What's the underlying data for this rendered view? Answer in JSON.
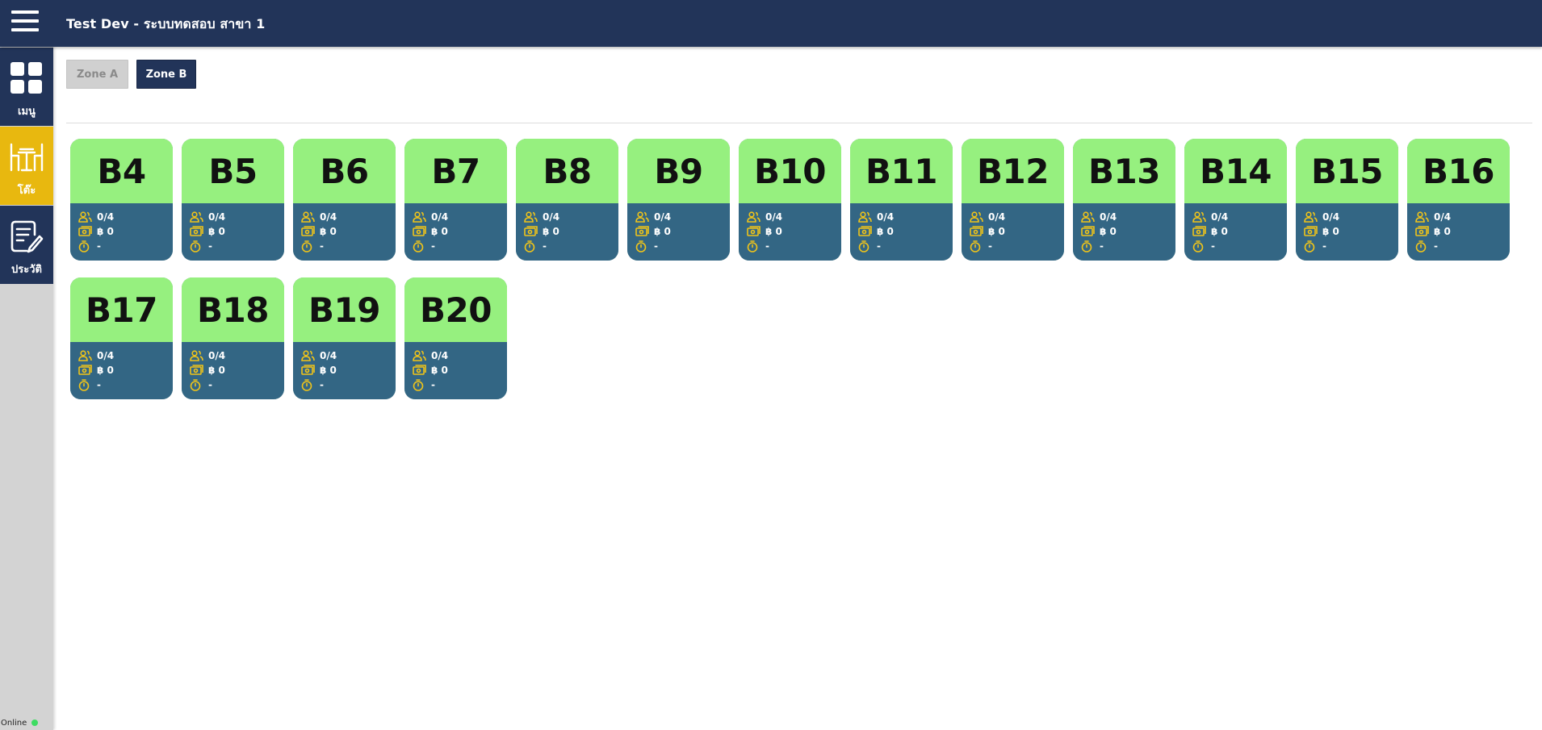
{
  "header": {
    "title": "Test Dev - ระบบทดสอบ สาขา 1"
  },
  "sidebar": {
    "items": [
      {
        "label": "เมนู",
        "icon": "grid-icon"
      },
      {
        "label": "โต๊ะ",
        "icon": "table-chairs-icon",
        "active": true
      },
      {
        "label": "ประวัติ",
        "icon": "history-document-icon"
      }
    ],
    "status": "Online",
    "status_color": "#3ddc62"
  },
  "zones": [
    {
      "label": "Zone A",
      "active": false
    },
    {
      "label": "Zone B",
      "active": true
    }
  ],
  "colors": {
    "header": "#223459",
    "active_nav": "#e8b80f",
    "card_top": "#96f07f",
    "card_bottom": "#336684",
    "icon_accent": "#f0c419"
  },
  "tables": [
    {
      "name": "B4",
      "guests": "0/4",
      "amount": "฿ 0",
      "time": "-"
    },
    {
      "name": "B5",
      "guests": "0/4",
      "amount": "฿ 0",
      "time": "-"
    },
    {
      "name": "B6",
      "guests": "0/4",
      "amount": "฿ 0",
      "time": "-"
    },
    {
      "name": "B7",
      "guests": "0/4",
      "amount": "฿ 0",
      "time": "-"
    },
    {
      "name": "B8",
      "guests": "0/4",
      "amount": "฿ 0",
      "time": "-"
    },
    {
      "name": "B9",
      "guests": "0/4",
      "amount": "฿ 0",
      "time": "-"
    },
    {
      "name": "B10",
      "guests": "0/4",
      "amount": "฿ 0",
      "time": "-"
    },
    {
      "name": "B11",
      "guests": "0/4",
      "amount": "฿ 0",
      "time": "-"
    },
    {
      "name": "B12",
      "guests": "0/4",
      "amount": "฿ 0",
      "time": "-"
    },
    {
      "name": "B13",
      "guests": "0/4",
      "amount": "฿ 0",
      "time": "-"
    },
    {
      "name": "B14",
      "guests": "0/4",
      "amount": "฿ 0",
      "time": "-"
    },
    {
      "name": "B15",
      "guests": "0/4",
      "amount": "฿ 0",
      "time": "-"
    },
    {
      "name": "B16",
      "guests": "0/4",
      "amount": "฿ 0",
      "time": "-"
    },
    {
      "name": "B17",
      "guests": "0/4",
      "amount": "฿ 0",
      "time": "-"
    },
    {
      "name": "B18",
      "guests": "0/4",
      "amount": "฿ 0",
      "time": "-"
    },
    {
      "name": "B19",
      "guests": "0/4",
      "amount": "฿ 0",
      "time": "-"
    },
    {
      "name": "B20",
      "guests": "0/4",
      "amount": "฿ 0",
      "time": "-"
    }
  ]
}
